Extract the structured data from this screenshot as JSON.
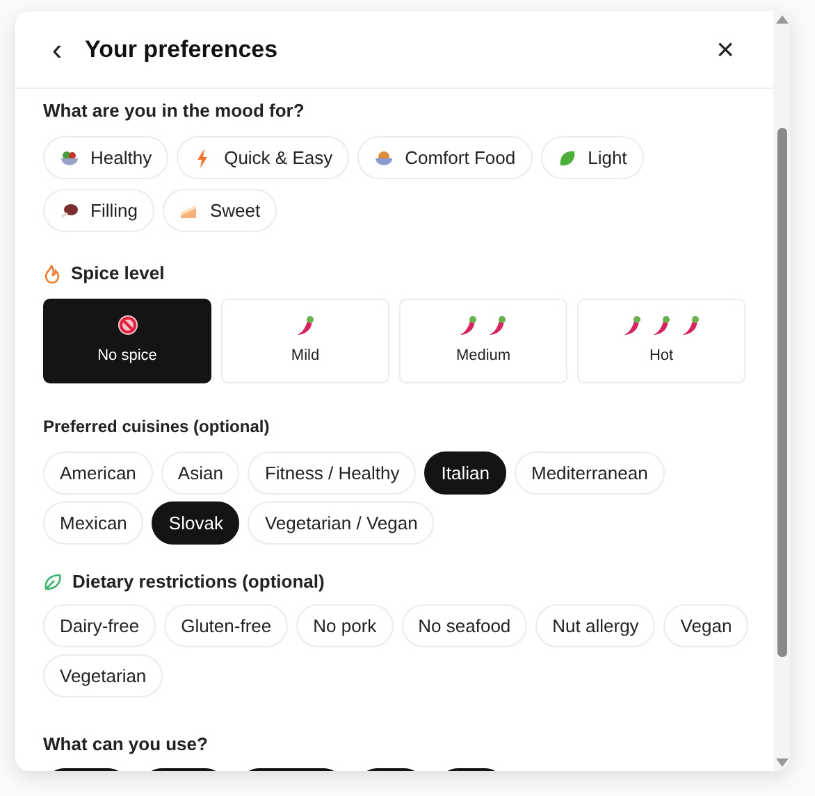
{
  "header": {
    "back": "‹",
    "title": "Your preferences",
    "close": "×"
  },
  "mood": {
    "title": "What are you in the mood for?",
    "items": [
      {
        "label": "Healthy",
        "kind": "salad",
        "selected": false
      },
      {
        "label": "Quick & Easy",
        "kind": "bolt",
        "selected": false
      },
      {
        "label": "Comfort Food",
        "kind": "stew",
        "selected": false
      },
      {
        "label": "Light",
        "kind": "leaf",
        "selected": false
      },
      {
        "label": "Filling",
        "kind": "meat",
        "selected": false
      },
      {
        "label": "Sweet",
        "kind": "cake",
        "selected": false
      }
    ]
  },
  "spice": {
    "title": "Spice level",
    "items": [
      {
        "label": "No spice",
        "kind": "none",
        "selected": true
      },
      {
        "label": "Mild",
        "kind": "mild",
        "selected": false
      },
      {
        "label": "Medium",
        "kind": "medium",
        "selected": false
      },
      {
        "label": "Hot",
        "kind": "hot",
        "selected": false
      }
    ]
  },
  "cuisines": {
    "title": "Preferred cuisines (optional)",
    "items": [
      {
        "label": "American",
        "selected": false
      },
      {
        "label": "Asian",
        "selected": false
      },
      {
        "label": "Fitness / Healthy",
        "selected": false
      },
      {
        "label": "Italian",
        "selected": true
      },
      {
        "label": "Mediterranean",
        "selected": false
      },
      {
        "label": "Mexican",
        "selected": false
      },
      {
        "label": "Slovak",
        "selected": true
      },
      {
        "label": "Vegetarian / Vegan",
        "selected": false
      }
    ]
  },
  "dietary": {
    "title": "Dietary restrictions (optional)",
    "items": [
      {
        "label": "Dairy-free",
        "selected": false
      },
      {
        "label": "Gluten-free",
        "selected": false
      },
      {
        "label": "No pork",
        "selected": false
      },
      {
        "label": "No seafood",
        "selected": false
      },
      {
        "label": "Nut allergy",
        "selected": false
      },
      {
        "label": "Vegan",
        "selected": false
      },
      {
        "label": "Vegetarian",
        "selected": false
      }
    ]
  },
  "equipment": {
    "title": "What can you use?",
    "items": [
      {
        "selected": true
      },
      {
        "selected": true
      },
      {
        "selected": true
      },
      {
        "selected": true
      },
      {
        "selected": true
      }
    ]
  }
}
